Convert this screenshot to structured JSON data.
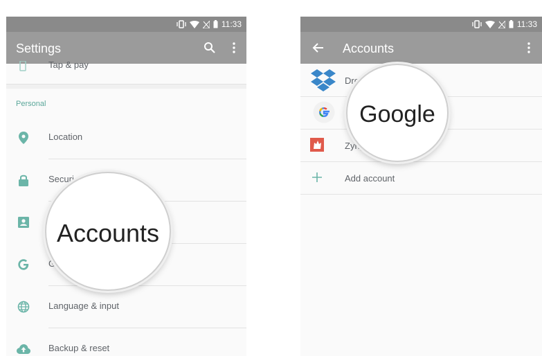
{
  "status_bar": {
    "time": "11:33"
  },
  "settings_screen": {
    "title": "Settings",
    "partial_top_item": "Tap & pay",
    "section_header": "Personal",
    "items": [
      {
        "label": "Location",
        "icon": "location-pin-icon"
      },
      {
        "label": "Securi",
        "icon": "lock-icon"
      },
      {
        "label": "Accounts",
        "icon": "account-box-icon"
      },
      {
        "label": "G",
        "icon": "google-icon"
      },
      {
        "label": "Language & input",
        "icon": "globe-icon"
      },
      {
        "label": "Backup & reset",
        "icon": "cloud-upload-icon"
      }
    ],
    "magnifier_text": "Accounts"
  },
  "accounts_screen": {
    "title": "Accounts",
    "items": [
      {
        "label": "Dro",
        "icon": "dropbox-icon"
      },
      {
        "label": "G",
        "icon": "google-logo-icon"
      },
      {
        "label": "Zyng",
        "icon": "zynga-icon"
      }
    ],
    "add_account": "Add account",
    "magnifier_text": "Google"
  },
  "colors": {
    "app_bar": "#9b9b9b",
    "status_bar": "#8a8a8a",
    "accent_teal": "#5ba79a",
    "dropbox_blue": "#3a87c9",
    "zynga_red": "#e05a4b"
  }
}
